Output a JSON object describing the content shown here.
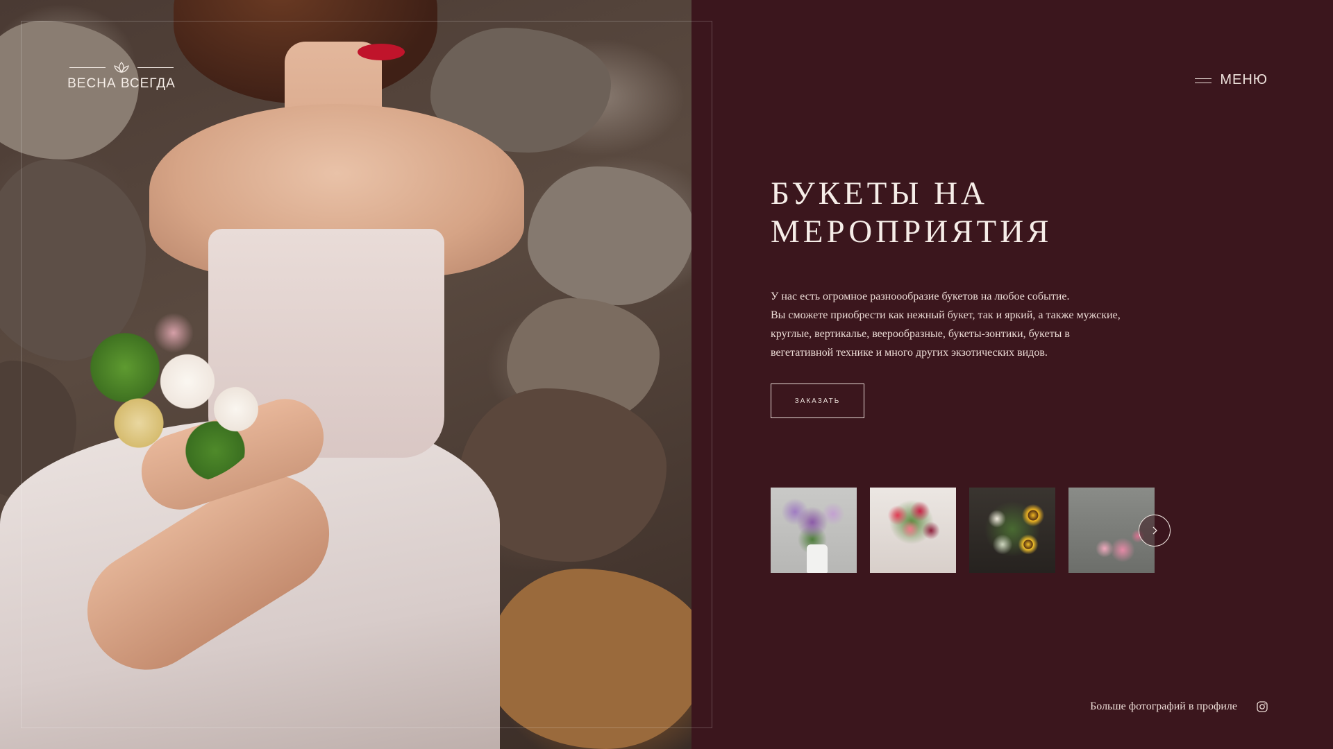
{
  "brand": {
    "logo_text": "ВЕСНА ВСЕГДА"
  },
  "header": {
    "menu_label": "МЕНЮ"
  },
  "hero": {
    "title_line_1": "БУКЕТЫ НА",
    "title_line_2": "МЕРОПРИЯТИЯ",
    "description_lines": [
      "У нас есть огромное разноообразие букетов на любое событие.",
      "Вы сможете приобрести как нежный букет, так и яркий, а также мужские,",
      "круглые, вертикалье, веерообразные, букеты-зонтики, букеты в",
      "вегетативной технике и много  других экзотических видов."
    ],
    "order_button_label": "ЗАКАЗАТЬ"
  },
  "gallery": {
    "thumbnails": [
      "lilac-bouquet",
      "red-rose-bouquet",
      "sunflower-bouquet",
      "pink-peony-bouquet"
    ],
    "next_icon": "chevron-right-icon"
  },
  "footer": {
    "profile_link_text": "Больше фотографий в профиле",
    "social_icon": "instagram-icon"
  },
  "colors": {
    "background": "#3b161d",
    "text": "#f3ebe7"
  }
}
